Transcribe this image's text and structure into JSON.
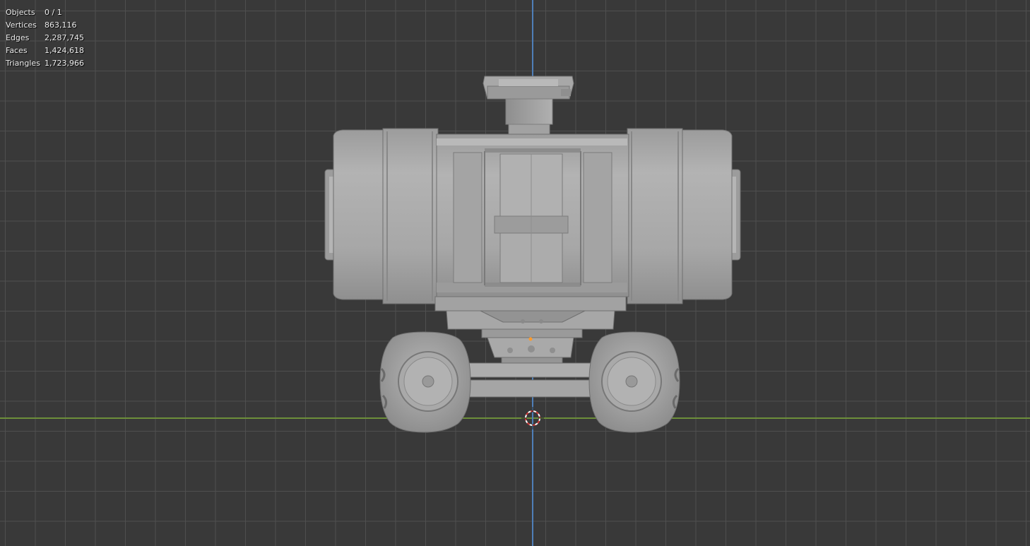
{
  "viewport": {
    "background_color": "#393939",
    "grid_color": "#505050",
    "x_axis_color": "#6d8f3a",
    "z_axis_color": "#4f7fb8",
    "model_color": "#a9a9a9"
  },
  "stats": {
    "objects_label": "Objects",
    "objects_value": "0 / 1",
    "vertices_label": "Vertices",
    "vertices_value": "863,116",
    "edges_label": "Edges",
    "edges_value": "2,287,745",
    "faces_label": "Faces",
    "faces_value": "1,424,618",
    "triangles_label": "Triangles",
    "triangles_value": "1,723,966"
  },
  "icons": {
    "cursor": "3d-cursor-icon",
    "origin": "object-origin-icon"
  }
}
